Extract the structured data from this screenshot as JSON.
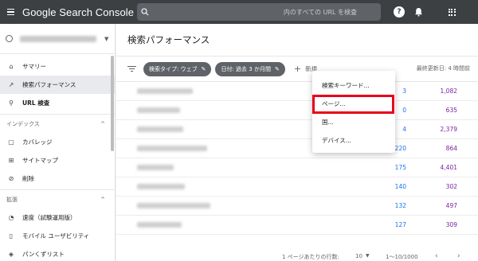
{
  "app": {
    "title": "Google Search Console",
    "search_placeholder": "内のすべての URL を検査"
  },
  "topbar": {
    "help_icon": "?",
    "bell_icon": "bell-icon",
    "apps_icon": "apps-grid-icon"
  },
  "sidebar": {
    "property_caret": "▼",
    "items": [
      {
        "label": "サマリー",
        "icon": "home-icon",
        "glyph": "⌂"
      },
      {
        "label": "検索パフォーマンス",
        "icon": "trending-icon",
        "glyph": "↗"
      },
      {
        "label": "URL 検査",
        "icon": "search-icon",
        "glyph": "⚲"
      }
    ],
    "index_section": {
      "label": "インデックス",
      "caret": "^"
    },
    "index_items": [
      {
        "label": "カバレッジ",
        "icon": "coverage-icon",
        "glyph": "▢"
      },
      {
        "label": "サイトマップ",
        "icon": "sitemap-icon",
        "glyph": "⊞"
      },
      {
        "label": "削除",
        "icon": "removal-icon",
        "glyph": "⊘"
      }
    ],
    "enhance_section": {
      "label": "拡張",
      "caret": "^"
    },
    "enhance_items": [
      {
        "label": "速度（試験運用版）",
        "icon": "speed-icon",
        "glyph": "◔"
      },
      {
        "label": "モバイル ユーザビリティ",
        "icon": "mobile-icon",
        "glyph": "▯"
      },
      {
        "label": "パンくずリスト",
        "icon": "breadcrumb-icon",
        "glyph": "◈"
      }
    ]
  },
  "main": {
    "page_title": "検索パフォーマンス",
    "chips": [
      {
        "label": "検索タイプ: ウェブ",
        "icon": "✎"
      },
      {
        "label": "日付: 過去 3 か月間",
        "icon": "✎"
      }
    ],
    "add_new": {
      "plus": "+",
      "label": "新規"
    },
    "last_updated": "最終更新日: 4 時間前",
    "rows": [
      {
        "clicks": "3",
        "impressions": "1,082"
      },
      {
        "clicks": "0",
        "impressions": "635"
      },
      {
        "clicks": "4",
        "impressions": "2,379"
      },
      {
        "clicks": "220",
        "impressions": "864"
      },
      {
        "clicks": "175",
        "impressions": "4,401"
      },
      {
        "clicks": "140",
        "impressions": "302"
      },
      {
        "clicks": "132",
        "impressions": "497"
      },
      {
        "clicks": "127",
        "impressions": "309"
      }
    ],
    "pagination": {
      "rows_per_page": "1 ページあたりの行数:",
      "count": "10",
      "caret": "▼",
      "range": "1〜10/1000",
      "prev": "‹",
      "next": "›"
    }
  },
  "dropdown": {
    "items": [
      "検索キーワード...",
      "ページ...",
      "国...",
      "デバイス..."
    ],
    "highlighted_index": 1,
    "highlight_color": "#e8001c"
  }
}
